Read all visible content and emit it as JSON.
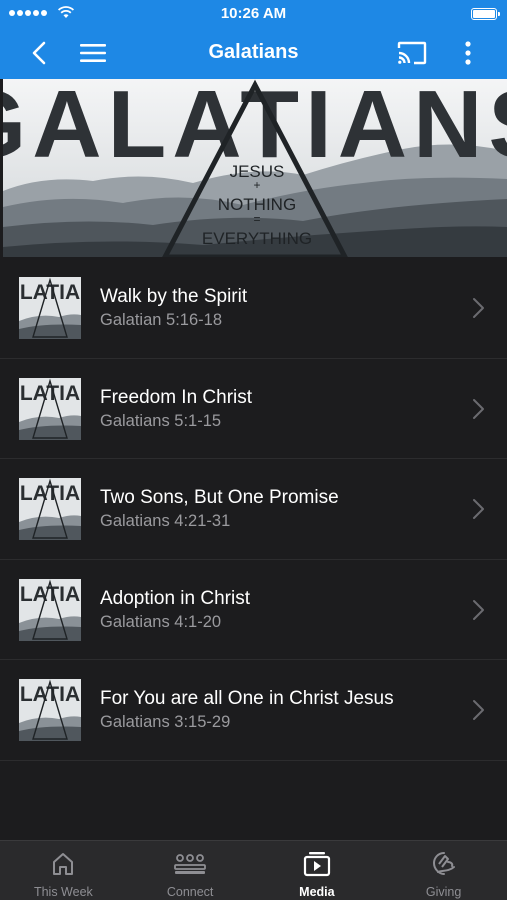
{
  "status_bar": {
    "time": "10:26 AM"
  },
  "nav": {
    "title": "Galatians"
  },
  "banner": {
    "big_text": "GALATIANS",
    "line1": "JESUS",
    "plus": "+",
    "line2": "NOTHING",
    "equals": "=",
    "line3": "EVERYTHING"
  },
  "thumb_text": "LATIA",
  "sermons": [
    {
      "title": "Walk by the Spirit",
      "ref": "Galatian 5:16-18"
    },
    {
      "title": "Freedom In Christ",
      "ref": "Galatians 5:1-15"
    },
    {
      "title": "Two Sons, But One Promise",
      "ref": "Galatians 4:21-31"
    },
    {
      "title": "Adoption in Christ",
      "ref": "Galatians 4:1-20"
    },
    {
      "title": "For You are all One in Christ Jesus",
      "ref": "Galatians 3:15-29"
    }
  ],
  "tabs": [
    {
      "label": "This Week",
      "icon": "home-icon"
    },
    {
      "label": "Connect",
      "icon": "group-icon"
    },
    {
      "label": "Media",
      "icon": "media-icon"
    },
    {
      "label": "Giving",
      "icon": "giving-icon"
    }
  ],
  "colors": {
    "accent": "#1e88e5",
    "background": "#1c1c1e",
    "tabbar": "#2a2a2c"
  }
}
